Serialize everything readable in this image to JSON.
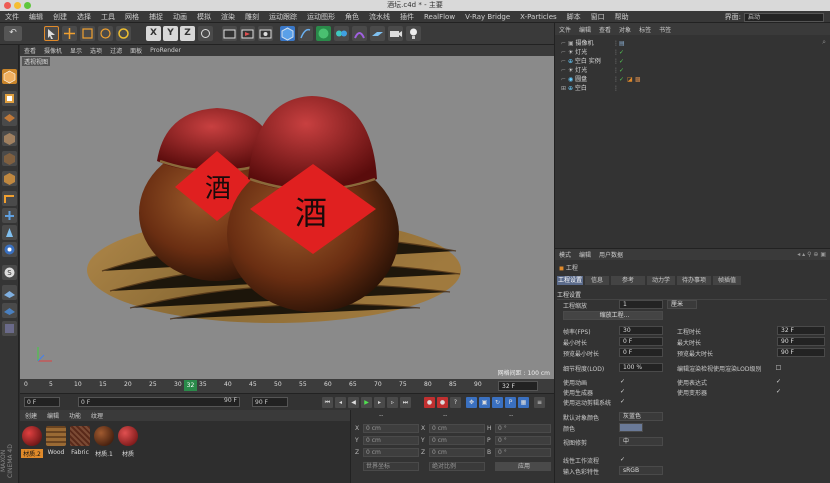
{
  "window": {
    "title": "酒坛.c4d * - 主要"
  },
  "menubar": {
    "items": [
      "文件",
      "编辑",
      "创建",
      "选择",
      "工具",
      "网格",
      "捕捉",
      "动画",
      "模拟",
      "渲染",
      "雕刻",
      "运动跟踪",
      "运动图形",
      "角色",
      "流水线",
      "插件",
      "RealFlow",
      "V-Ray Bridge",
      "X-Particles",
      "脚本",
      "窗口",
      "帮助"
    ],
    "layout_label": "界面:",
    "layout_value": "启动"
  },
  "toolbar": {
    "axis_labels": [
      "X",
      "Y",
      "Z"
    ]
  },
  "viewport": {
    "menu": [
      "查看",
      "摄像机",
      "显示",
      "选项",
      "过滤",
      "面板",
      "ProRender"
    ],
    "view_name": "透视视图",
    "grid_info": "网格间距 : 100 cm",
    "label_char": "酒"
  },
  "timeline": {
    "ticks": [
      "0",
      "5",
      "10",
      "15",
      "20",
      "25",
      "30",
      "35",
      "40",
      "45",
      "50",
      "55",
      "60",
      "65",
      "70",
      "75",
      "80",
      "85",
      "90"
    ],
    "current_frame_marker": "32",
    "end_frame_field": "32 F"
  },
  "playbar": {
    "start_field": "0 F",
    "current_field": "0 F",
    "end_field": "90 F",
    "max_field": "90 F"
  },
  "material_manager": {
    "menu": [
      "创建",
      "编辑",
      "功能",
      "纹理"
    ],
    "materials": [
      {
        "label": "材质.2",
        "color": "#8a1a1a"
      },
      {
        "label": "Wood",
        "color": "#8a5a2a"
      },
      {
        "label": "Fabric",
        "color": "#6a3a2a"
      },
      {
        "label": "材质.1",
        "color": "#6a2a1a"
      },
      {
        "label": "材质",
        "color": "#a01818"
      }
    ],
    "logo_text": "MAXON CINEMA 4D"
  },
  "coordinates": {
    "header": [
      "--",
      "--",
      "--"
    ],
    "rows": [
      {
        "axis": "X",
        "pos": "0 cm",
        "axis2": "X",
        "size": "0 cm",
        "rot_axis": "H",
        "rot": "0 °"
      },
      {
        "axis": "Y",
        "pos": "0 cm",
        "axis2": "Y",
        "size": "0 cm",
        "rot_axis": "P",
        "rot": "0 °"
      },
      {
        "axis": "Z",
        "pos": "0 cm",
        "axis2": "Z",
        "size": "0 cm",
        "rot_axis": "B",
        "rot": "0 °"
      }
    ],
    "world_label": "世界坐标",
    "scale_label": "绝对比例",
    "apply_label": "应用"
  },
  "object_manager": {
    "menu": [
      "文件",
      "编辑",
      "查看",
      "对象",
      "标签",
      "书签"
    ],
    "objects": [
      {
        "name": "摄像机",
        "indent": 0
      },
      {
        "name": "灯光",
        "indent": 0
      },
      {
        "name": "空白 实例",
        "indent": 0
      },
      {
        "name": "灯光",
        "indent": 0
      },
      {
        "name": "圆盘",
        "indent": 0
      },
      {
        "name": "空白",
        "indent": 0
      }
    ]
  },
  "attribute_manager": {
    "menu": [
      "模式",
      "编辑",
      "用户数据"
    ],
    "section": "工程",
    "tabs": [
      "工程设置",
      "信息",
      "参考",
      "动力学",
      "待办事项",
      "帧插值"
    ],
    "group_title": "工程设置",
    "scale_label": "工程缩放",
    "scale_value": "1",
    "scale_unit": "厘米",
    "scale_button": "缩放工程...",
    "fps_label": "帧率(FPS)",
    "fps_value": "30",
    "duration_label": "工程时长",
    "duration_value": "32 F",
    "min_time_label": "最小时长",
    "min_time_value": "0 F",
    "max_time_label": "最大时长",
    "max_time_value": "90 F",
    "preview_min_label": "预览最小时长",
    "preview_min_value": "0 F",
    "preview_max_label": "预览最大时长",
    "preview_max_value": "90 F",
    "lod_label": "细节程度(LOD)",
    "lod_value": "100 %",
    "lod_render_label": "编辑渲染检视使用渲染LOD级别",
    "use_anim_label": "使用动画",
    "use_expr_label": "使用表达式",
    "use_gen_label": "使用生成器",
    "use_deform_label": "使用变形器",
    "use_motion_label": "使用运动剪辑系统",
    "default_color_label": "默认对象颜色",
    "default_color_value": "灰蓝色",
    "color_label": "颜色",
    "view_clip_label": "视图修剪",
    "view_clip_value": "中",
    "linear_label": "线性工作流程",
    "input_color_label": "输入色彩特性",
    "input_color_value": "sRGB"
  }
}
